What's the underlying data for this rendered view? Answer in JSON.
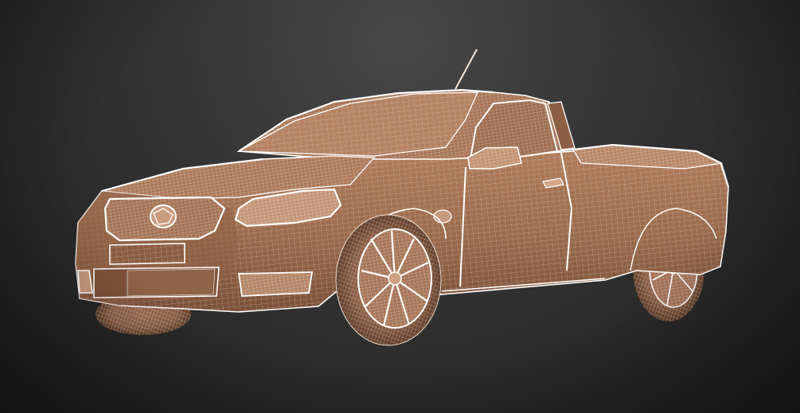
{
  "scene": {
    "subject": "wireframe-pickup-truck",
    "colors": {
      "background": "#333333",
      "body_fill": "#9a6a4c",
      "body_shadow": "#6e4630",
      "wire": "#f3e6da",
      "wire_bright": "#ffffff",
      "tire": "#8a5e45",
      "glass": "#a87658"
    },
    "labels": []
  }
}
